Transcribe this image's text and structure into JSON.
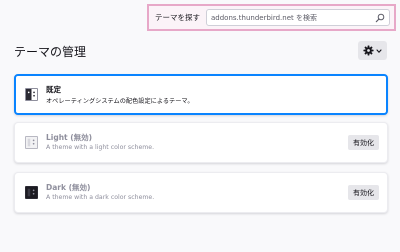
{
  "header": {
    "search_label": "テーマを探す",
    "search_placeholder": "addons.thunderbird.net を検索"
  },
  "page_title": "テーマの管理",
  "themes": [
    {
      "name": "既定",
      "description": "オペレーティングシステムの配色設定によるテーマ。",
      "active": true
    },
    {
      "name": "Light (無効)",
      "description": "A theme with a light color scheme.",
      "button": "有効化",
      "active": false
    },
    {
      "name": "Dark (無効)",
      "description": "A theme with a dark color scheme.",
      "button": "有効化",
      "active": false
    }
  ],
  "colors": {
    "accent": "#0a84ff",
    "search_highlight": "#e7a8c8"
  },
  "icons": {
    "search": "search-icon",
    "settings": "gear-icon",
    "dropdown": "chevron-down-icon"
  }
}
